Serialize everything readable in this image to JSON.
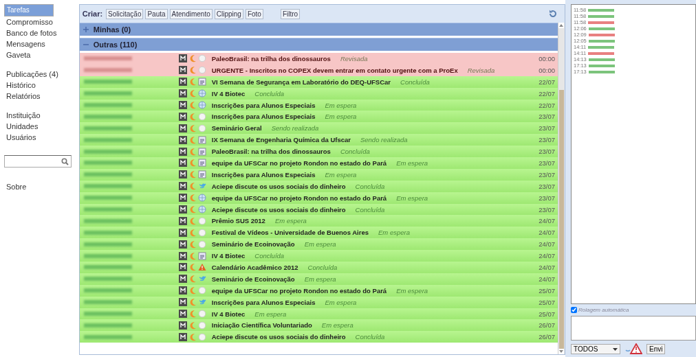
{
  "sidebar": {
    "groups": [
      [
        {
          "label": "Tarefas",
          "selected": true
        },
        {
          "label": "Compromisso",
          "selected": false
        },
        {
          "label": "Banco de fotos",
          "selected": false
        },
        {
          "label": "Mensagens",
          "selected": false
        },
        {
          "label": "Gaveta",
          "selected": false
        }
      ],
      [
        {
          "label": "Publicações (4)",
          "selected": false
        },
        {
          "label": "Histórico",
          "selected": false
        },
        {
          "label": "Relatórios",
          "selected": false
        }
      ],
      [
        {
          "label": "Instituição",
          "selected": false
        },
        {
          "label": "Unidades",
          "selected": false
        },
        {
          "label": "Usuários",
          "selected": false
        }
      ]
    ],
    "about": "Sobre"
  },
  "toolbar": {
    "label": "Criar:",
    "buttons": [
      "Solicitação",
      "Pauta",
      "Atendimento",
      "Clipping",
      "Foto"
    ],
    "filter": "Filtro"
  },
  "sections": [
    {
      "label": "Minhas (0)",
      "expanded": false
    },
    {
      "label": "Outras (110)",
      "expanded": true
    }
  ],
  "rows": [
    {
      "kind": "pink",
      "title": "PaleoBrasil: na trilha dos dinossauros",
      "status": "Revisada",
      "date": "00:00"
    },
    {
      "kind": "pink",
      "title": "URGENTE - Inscritos no COPEX devem entrar em contato urgente com a ProEx",
      "status": "Revisada",
      "date": "00:00"
    },
    {
      "kind": "green",
      "title": "VI Semana de Segurança em Laboratório do DEQ-UFSCar",
      "status": "Concluída",
      "date": "22/07"
    },
    {
      "kind": "green",
      "title": "IV 4 Biotec",
      "status": "Concluída",
      "date": "22/07"
    },
    {
      "kind": "green",
      "title": "Inscrições para Alunos Especiais",
      "status": "Em espera",
      "date": "22/07"
    },
    {
      "kind": "green",
      "title": "Inscrições para Alunos Especiais",
      "status": "Em espera",
      "date": "23/07"
    },
    {
      "kind": "green",
      "title": "Seminário Geral",
      "status": "Sendo realizada",
      "date": "23/07"
    },
    {
      "kind": "green",
      "title": "IX Semana de Engenharia Química da Ufscar",
      "status": "Sendo realizada",
      "date": "23/07"
    },
    {
      "kind": "green",
      "title": "PaleoBrasil: na trilha dos dinossauros",
      "status": "Concluída",
      "date": "23/07"
    },
    {
      "kind": "green",
      "title": "equipe da UFSCar no projeto Rondon no estado do Pará",
      "status": "Em espera",
      "date": "23/07"
    },
    {
      "kind": "green",
      "title": "Inscrições para Alunos Especiais",
      "status": "Em espera",
      "date": "23/07"
    },
    {
      "kind": "green",
      "title": "Aciepe discute os usos sociais do dinheiro",
      "status": "Concluída",
      "date": "23/07"
    },
    {
      "kind": "green",
      "title": "equipe da UFSCar no projeto Rondon no estado do Pará",
      "status": "Em espera",
      "date": "23/07"
    },
    {
      "kind": "green",
      "title": "Aciepe discute os usos sociais do dinheiro",
      "status": "Concluída",
      "date": "23/07"
    },
    {
      "kind": "green",
      "title": "Prêmio SUS 2012",
      "status": "Em espera",
      "date": "24/07"
    },
    {
      "kind": "green",
      "title": "Festival de Vídeos - Universidade de Buenos Aires",
      "status": "Em espera",
      "date": "24/07"
    },
    {
      "kind": "green",
      "title": "Seminário de Ecoinovação",
      "status": "Em espera",
      "date": "24/07"
    },
    {
      "kind": "green",
      "title": "IV 4 Biotec",
      "status": "Concluída",
      "date": "24/07"
    },
    {
      "kind": "green",
      "title": "Calendário Acadêmico 2012",
      "status": "Concluída",
      "date": "24/07"
    },
    {
      "kind": "green",
      "title": "Seminário de Ecoinovação",
      "status": "Em espera",
      "date": "24/07"
    },
    {
      "kind": "green",
      "title": "equipe da UFSCar no projeto Rondon no estado do Pará",
      "status": "Em espera",
      "date": "25/07"
    },
    {
      "kind": "green",
      "title": "Inscrições para Alunos Especiais",
      "status": "Em espera",
      "date": "25/07"
    },
    {
      "kind": "green",
      "title": "IV 4 Biotec",
      "status": "Em espera",
      "date": "25/07"
    },
    {
      "kind": "green",
      "title": "Iniciação Científica Voluntariado",
      "status": "Em espera",
      "date": "26/07"
    },
    {
      "kind": "green",
      "title": "Aciepe discute os usos sociais do dinheiro",
      "status": "Concluída",
      "date": "26/07"
    }
  ],
  "chat": {
    "log": [
      {
        "time": "11:58",
        "color": "#7cc47c"
      },
      {
        "time": "11:58",
        "color": "#7cc47c"
      },
      {
        "time": "11:58",
        "color": "#e88080"
      },
      {
        "time": "12:06",
        "color": "#7cc47c"
      },
      {
        "time": "12:09",
        "color": "#e88080"
      },
      {
        "time": "12:05",
        "color": "#7cc47c"
      },
      {
        "time": "14:11",
        "color": "#7cc47c"
      },
      {
        "time": "14:11",
        "color": "#e88080"
      },
      {
        "time": "14:13",
        "color": "#7cc47c"
      },
      {
        "time": "17:13",
        "color": "#7cc47c"
      },
      {
        "time": "17:13",
        "color": "#7cc47c"
      }
    ],
    "autoscroll": {
      "label": "Rolagem automática",
      "checked": true
    },
    "recipient": "TODOS",
    "send": "Envi"
  }
}
